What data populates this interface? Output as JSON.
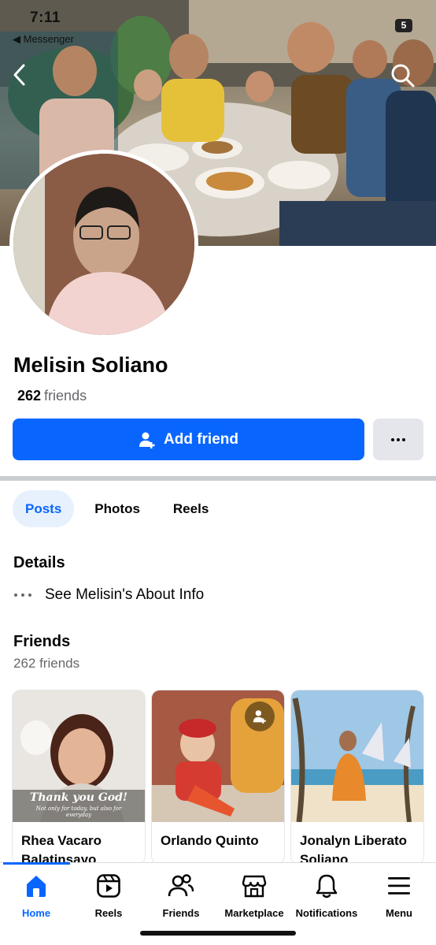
{
  "status_bar": {
    "time": "7:11",
    "back_app": "◀ Messenger",
    "battery": "5"
  },
  "profile": {
    "name": "Melisin Soliano",
    "friend_count": "262",
    "friend_count_label": "friends"
  },
  "actions": {
    "add_friend_label": "Add friend",
    "more_label": "···"
  },
  "tabs": [
    {
      "label": "Posts",
      "active": true
    },
    {
      "label": "Photos",
      "active": false
    },
    {
      "label": "Reels",
      "active": false
    }
  ],
  "details": {
    "title": "Details",
    "about_link": "See Melisin's About Info"
  },
  "friends": {
    "title": "Friends",
    "subtitle": "262 friends",
    "cards": [
      {
        "name": "Rhea Vacaro Balatinsayo",
        "photo_caption_1": "Thank you God!",
        "photo_caption_2": "Not only for today, but also for everyday"
      },
      {
        "name": "Orlando Quinto"
      },
      {
        "name": "Jonalyn Liberato Soliano"
      }
    ]
  },
  "bottom_nav": [
    {
      "label": "Home",
      "icon": "home-icon",
      "active": true
    },
    {
      "label": "Reels",
      "icon": "reels-icon",
      "active": false
    },
    {
      "label": "Friends",
      "icon": "friends-icon",
      "active": false
    },
    {
      "label": "Marketplace",
      "icon": "marketplace-icon",
      "active": false
    },
    {
      "label": "Notifications",
      "icon": "bell-icon",
      "active": false
    },
    {
      "label": "Menu",
      "icon": "menu-icon",
      "active": false
    }
  ],
  "colors": {
    "accent": "#0866ff",
    "secondary_text": "#65676b",
    "button_gray": "#e4e6eb"
  }
}
